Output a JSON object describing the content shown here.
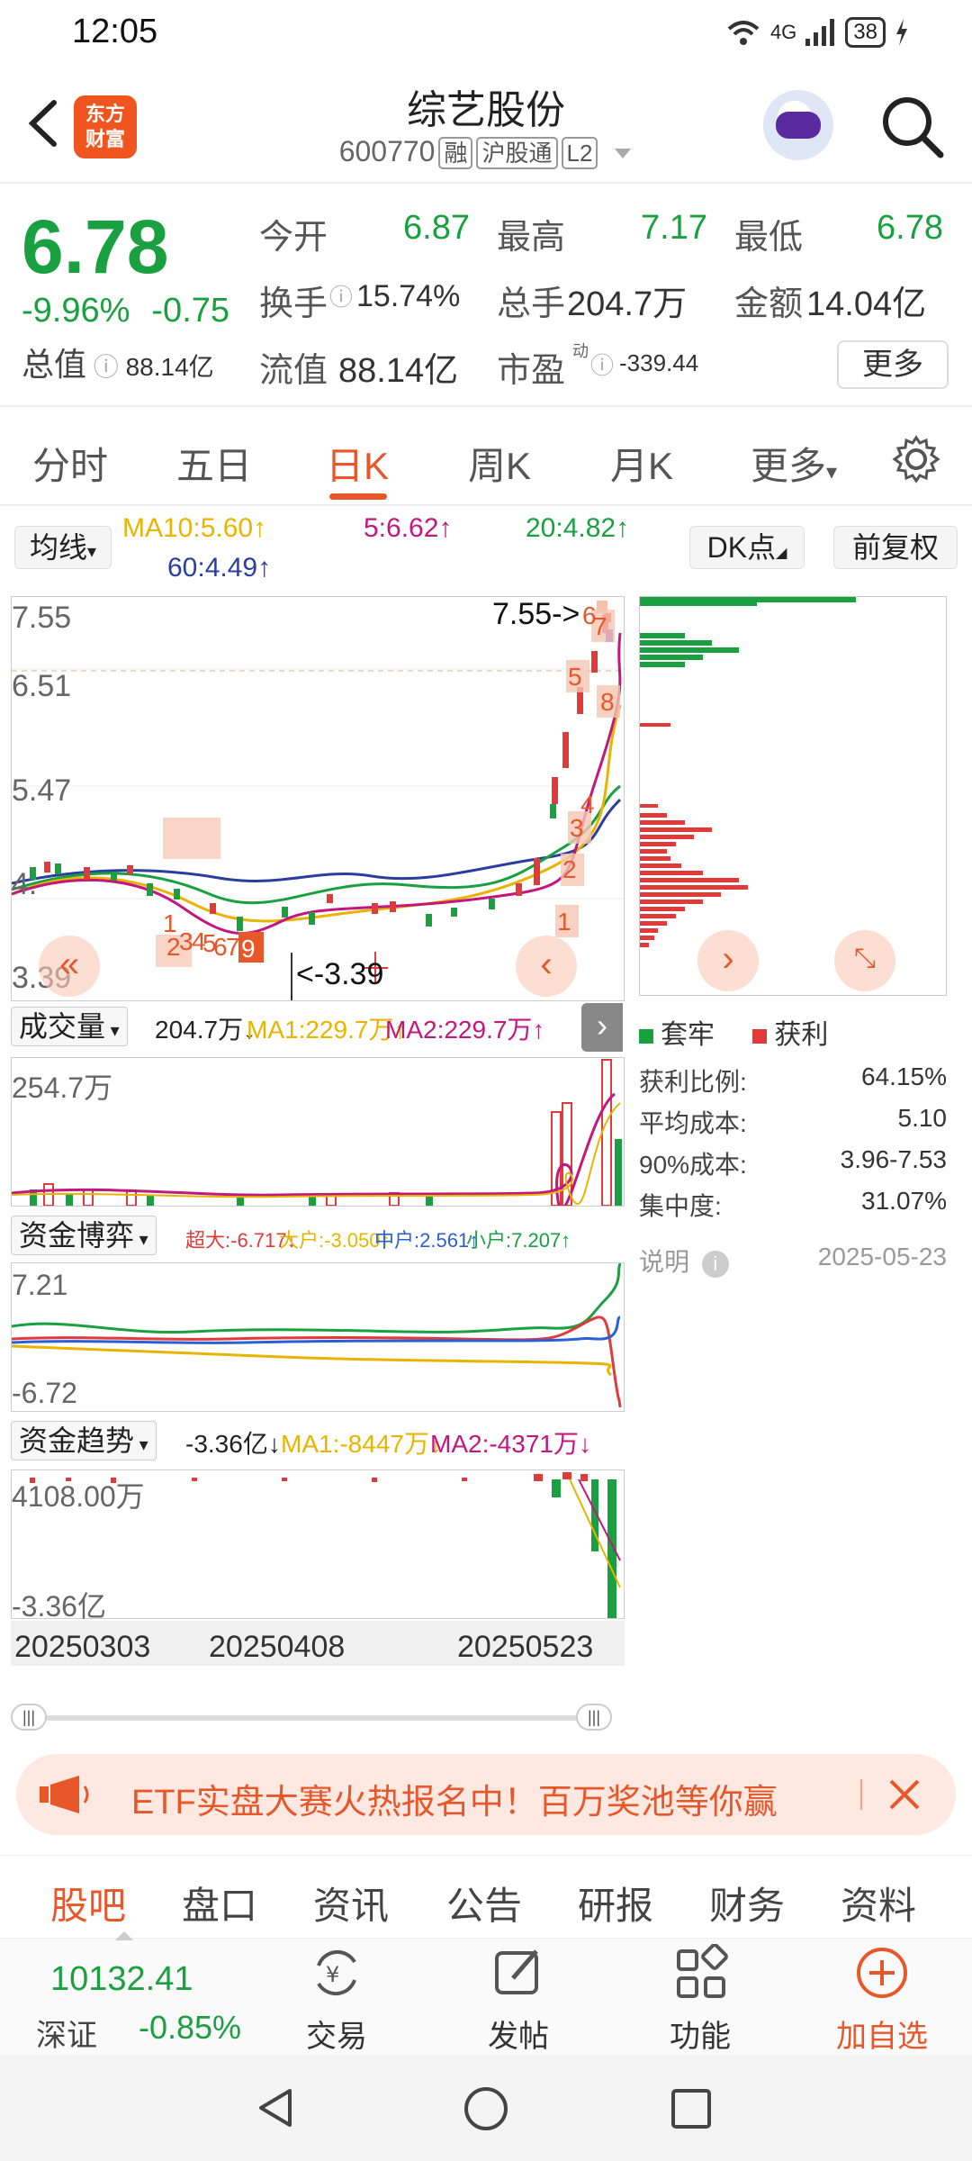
{
  "status_bar": {
    "time": "12:05",
    "network": "4G",
    "battery": "38"
  },
  "header": {
    "brand": "东方财富",
    "stock_name": "综艺股份",
    "stock_code": "600770",
    "tags": [
      "融",
      "沪股通",
      "L2"
    ]
  },
  "quote": {
    "price": "6.78",
    "change_pct": "-9.96%",
    "change": "-0.75",
    "total_value_label": "总值",
    "total_value": "88.14亿",
    "open_label": "今开",
    "open": "6.87",
    "high_label": "最高",
    "high": "7.17",
    "low_label": "最低",
    "low": "6.78",
    "turnover_label": "换手",
    "turnover": "15.74%",
    "volume_label": "总手",
    "volume": "204.7万",
    "amount_label": "金额",
    "amount": "14.04亿",
    "float_label": "流值",
    "float_value": "88.14亿",
    "pe_label": "市盈",
    "pe_sup": "动",
    "pe": "-339.44",
    "more_label": "更多"
  },
  "chart_tabs": {
    "items": [
      "分时",
      "五日",
      "日K",
      "周K",
      "月K",
      "更多"
    ],
    "active": "日K"
  },
  "ma_bar": {
    "button": "均线",
    "ma10": "MA10:5.60↑",
    "ma5": "5:6.62↑",
    "ma20": "20:4.82↑",
    "ma60": "60:4.49↑",
    "dk_button": "DK点",
    "restore_button": "前复权"
  },
  "main_chart": {
    "y_top": "7.55",
    "y_2": "6.51",
    "y_3": "5.47",
    "y_4": "4.",
    "y_bottom": "3.39",
    "high_marker": "7.55->",
    "low_marker": "<-3.39"
  },
  "volume_panel": {
    "button": "成交量",
    "value": "204.7万↓",
    "ma1": "MA1:229.7万↑",
    "ma2": "MA2:229.7万↑",
    "y_top": "254.7万"
  },
  "fund_game": {
    "button": "资金博弈",
    "super_large": "超大:-6.717↓",
    "large": "大户:-3.050↑",
    "medium": "中户:2.561↑",
    "small": "小户:7.207↑",
    "y_top": "7.21",
    "y_bottom": "-6.72"
  },
  "fund_trend": {
    "button": "资金趋势",
    "value": "-3.36亿↓",
    "ma1": "MA1:-8447万↓",
    "ma2": "MA2:-4371万↓",
    "y_top": "4108.00万",
    "y_bottom": "-3.36亿"
  },
  "dates": [
    "20250303",
    "20250408",
    "20250523"
  ],
  "cost_distribution": {
    "legend_trapped": "套牢",
    "legend_profit": "获利",
    "profit_ratio_label": "获利比例:",
    "profit_ratio": "64.15%",
    "avg_cost_label": "平均成本:",
    "avg_cost": "5.10",
    "cost90_label": "90%成本:",
    "cost90": "3.96-7.53",
    "concentration_label": "集中度:",
    "concentration": "31.07%",
    "note_label": "说明",
    "date": "2025-05-23"
  },
  "banner": {
    "text": "ETF实盘大赛火热报名中！百万奖池等你赢"
  },
  "bottom_tabs": {
    "items": [
      "股吧",
      "盘口",
      "资讯",
      "公告",
      "研报",
      "财务",
      "资料"
    ],
    "active": "股吧"
  },
  "dock": {
    "index_value": "10132.41",
    "index_name": "深证",
    "index_change": "-0.85%",
    "trade": "交易",
    "post": "发帖",
    "functions": "功能",
    "add_watch": "加自选"
  },
  "colors": {
    "up_red": "#e03a3a",
    "down_green": "#1aa040",
    "accent": "#e8572a",
    "ma10": "#e8b400",
    "ma5": "#c2187d",
    "ma20": "#1aa040",
    "ma60": "#2b3ea0"
  }
}
